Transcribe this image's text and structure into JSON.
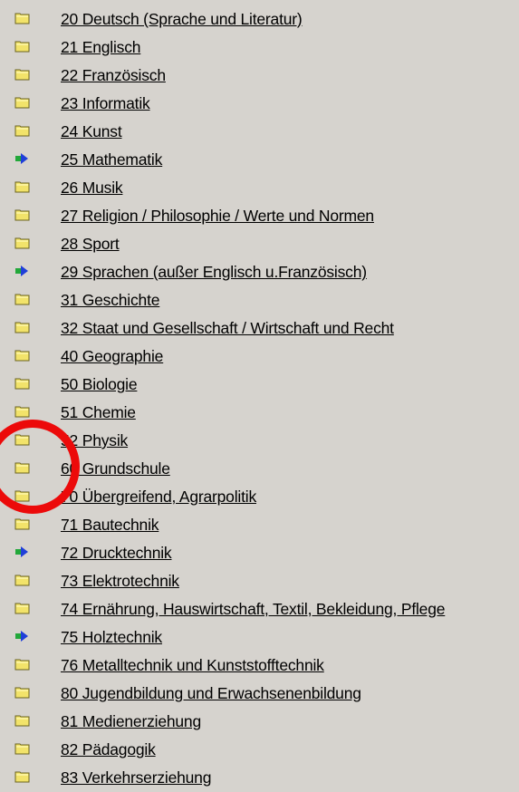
{
  "items": [
    {
      "label": "20 Deutsch (Sprache und Literatur)",
      "icon": "folder-icon"
    },
    {
      "label": "21 Englisch",
      "icon": "folder-icon"
    },
    {
      "label": "22 Französisch",
      "icon": "folder-icon"
    },
    {
      "label": "23 Informatik",
      "icon": "folder-icon"
    },
    {
      "label": "24 Kunst",
      "icon": "folder-icon"
    },
    {
      "label": "25 Mathematik",
      "icon": "arrow-right-icon"
    },
    {
      "label": "26 Musik",
      "icon": "folder-icon"
    },
    {
      "label": "27 Religion / Philosophie / Werte und Normen",
      "icon": "folder-icon"
    },
    {
      "label": "28 Sport",
      "icon": "folder-icon"
    },
    {
      "label": "29 Sprachen (außer Englisch u.Französisch)",
      "icon": "arrow-right-icon"
    },
    {
      "label": "31 Geschichte",
      "icon": "folder-icon"
    },
    {
      "label": "32 Staat und Gesellschaft / Wirtschaft und Recht",
      "icon": "folder-icon"
    },
    {
      "label": "40 Geographie",
      "icon": "folder-icon"
    },
    {
      "label": "50 Biologie",
      "icon": "folder-icon"
    },
    {
      "label": "51 Chemie",
      "icon": "folder-icon"
    },
    {
      "label": "52 Physik",
      "icon": "folder-icon"
    },
    {
      "label": "60 Grundschule",
      "icon": "folder-icon"
    },
    {
      "label": "70 Übergreifend, Agrarpolitik",
      "icon": "folder-icon"
    },
    {
      "label": "71 Bautechnik",
      "icon": "folder-icon"
    },
    {
      "label": "72 Drucktechnik",
      "icon": "arrow-right-icon"
    },
    {
      "label": "73 Elektrotechnik",
      "icon": "folder-icon"
    },
    {
      "label": "74 Ernährung, Hauswirtschaft, Textil, Bekleidung, Pflege",
      "icon": "folder-icon"
    },
    {
      "label": "75 Holztechnik",
      "icon": "arrow-right-icon"
    },
    {
      "label": "76 Metalltechnik und Kunststofftechnik",
      "icon": "folder-icon"
    },
    {
      "label": "80 Jugendbildung und Erwachsenenbildung",
      "icon": "folder-icon"
    },
    {
      "label": "81 Medienerziehung",
      "icon": "folder-icon"
    },
    {
      "label": "82 Pädagogik",
      "icon": "folder-icon"
    },
    {
      "label": "83 Verkehrserziehung",
      "icon": "folder-icon"
    }
  ],
  "colors": {
    "background": "#d6d3ce",
    "folder_fill": "#f2e36a",
    "folder_tab": "#fbf29a",
    "folder_outline": "#6b6320",
    "arrow_fill": "#1f3fd9",
    "arrow_tail": "#22a83a",
    "annotation_circle": "#ec0a0a"
  }
}
